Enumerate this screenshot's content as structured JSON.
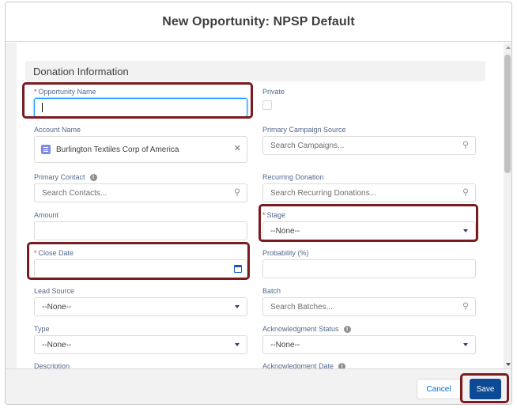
{
  "modal": {
    "title": "New Opportunity: NPSP Default"
  },
  "section": {
    "title": "Donation Information"
  },
  "fields": {
    "opportunity_name": {
      "required_mark": "*",
      "label": "Opportunity Name",
      "value": ""
    },
    "private": {
      "label": "Private",
      "checked": false
    },
    "account_name": {
      "label": "Account Name",
      "value": "Burlington Textiles Corp of America"
    },
    "primary_campaign_source": {
      "label": "Primary Campaign Source",
      "placeholder": "Search Campaigns..."
    },
    "primary_contact": {
      "label": "Primary Contact",
      "placeholder": "Search Contacts..."
    },
    "recurring_donation": {
      "label": "Recurring Donation",
      "placeholder": "Search Recurring Donations..."
    },
    "amount": {
      "label": "Amount",
      "value": ""
    },
    "stage": {
      "required_mark": "*",
      "label": "Stage",
      "value": "--None--"
    },
    "close_date": {
      "required_mark": "*",
      "label": "Close Date",
      "value": ""
    },
    "probability": {
      "label": "Probability (%)",
      "value": ""
    },
    "lead_source": {
      "label": "Lead Source",
      "value": "--None--"
    },
    "batch": {
      "label": "Batch",
      "placeholder": "Search Batches..."
    },
    "type": {
      "label": "Type",
      "value": "--None--"
    },
    "acknowledgment_status": {
      "label": "Acknowledgment Status",
      "value": "--None--"
    },
    "description": {
      "label": "Description"
    },
    "acknowledgment_date": {
      "label": "Acknowledgment Date"
    }
  },
  "icons": {
    "search": "search-icon",
    "dropdown": "chevron-down-icon",
    "calendar": "calendar-icon",
    "clear": "close-icon",
    "info": "info-icon",
    "account": "account-icon"
  },
  "footer": {
    "cancel_label": "Cancel",
    "save_label": "Save"
  },
  "colors": {
    "brand_button": "#0d4a96",
    "link": "#0070d2",
    "required": "#c23934",
    "highlight": "#7a1b1f"
  }
}
